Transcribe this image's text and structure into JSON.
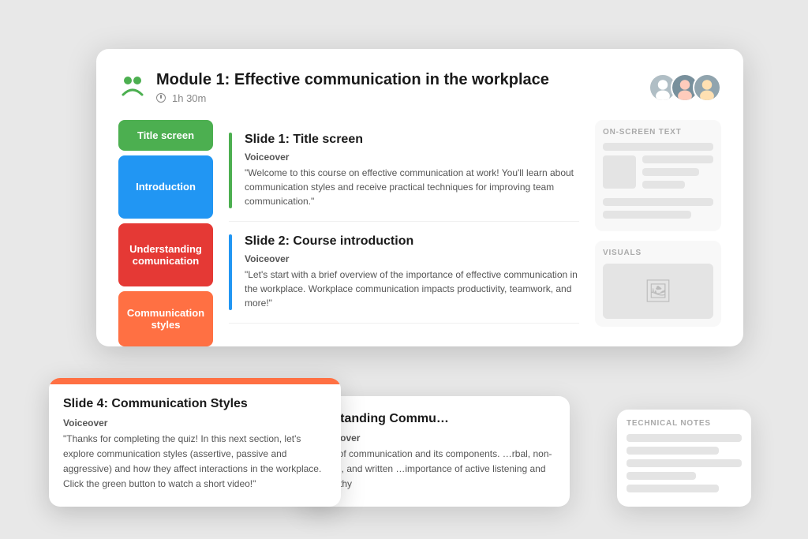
{
  "module": {
    "title": "Module 1: Effective communication in the workplace",
    "duration": "1h 30m",
    "logo_alt": "Articulate logo"
  },
  "sidebar": {
    "items": [
      {
        "label": "Title screen",
        "color": "green"
      },
      {
        "label": "Introduction",
        "color": "blue"
      },
      {
        "label": "Understanding comunication",
        "color": "red"
      },
      {
        "label": "Communication styles",
        "color": "orange"
      }
    ]
  },
  "slides": [
    {
      "id": 1,
      "title": "Slide 1: Title screen",
      "indicator_color": "green",
      "voiceover_label": "Voiceover",
      "voiceover_text": "\"Welcome to this course on effective communication at work! You'll learn about communication styles and receive practical techniques for improving team communication.\""
    },
    {
      "id": 2,
      "title": "Slide 2: Course introduction",
      "indicator_color": "blue",
      "voiceover_label": "Voiceover",
      "voiceover_text": "\"Let's start with a brief overview of the importance of effective communication in the workplace. Workplace communication impacts productivity, teamwork, and more!\""
    }
  ],
  "panels": {
    "on_screen_text": {
      "label": "ON-SCREEN TEXT"
    },
    "visuals": {
      "label": "VISUALS"
    },
    "technical_notes": {
      "label": "TECHNICAL NOTES"
    }
  },
  "tooltip": {
    "title": "Slide 4: Communication Styles",
    "voiceover_label": "Voiceover",
    "text": "\"Thanks for completing the quiz! In this next section, let's explore communication styles (assertive, passive and aggressive) and how they affect interactions in the workplace. Click the green button to watch a short video!\""
  },
  "overlay": {
    "title": "…rstanding Commu…",
    "voiceover_label": "Voiceover",
    "text": "…on of communication and its components. …rbal, non-verbal, and written …importance of active listening and empathy"
  }
}
